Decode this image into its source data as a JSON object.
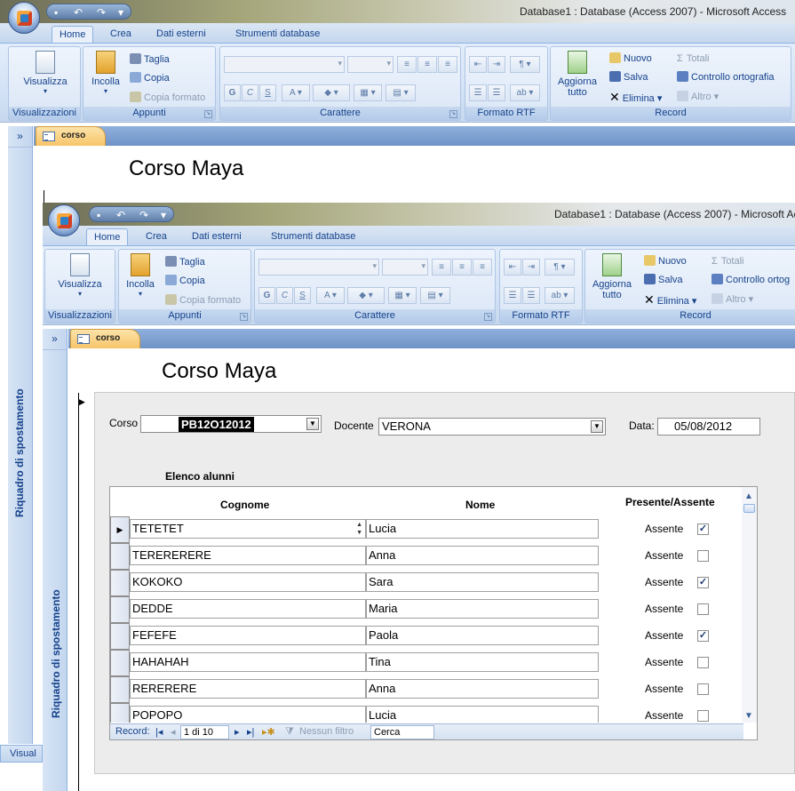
{
  "window_title": "Database1 : Database (Access 2007) - Microsoft Access",
  "window_title_inner": "Database1 : Database (Access 2007) - Microsoft Acc",
  "tabs": [
    "Home",
    "Crea",
    "Dati esterni",
    "Strumenti database"
  ],
  "ribbon": {
    "visualizza": "Visualizza",
    "incolla": "Incolla",
    "taglia": "Taglia",
    "copia": "Copia",
    "copia_formato": "Copia formato",
    "aggiorna_1": "Aggiorna",
    "aggiorna_2": "tutto",
    "nuovo": "Nuovo",
    "salva": "Salva",
    "elimina": "Elimina",
    "totali": "Totali",
    "controllo": "Controllo ortografia",
    "controllo_inner": "Controllo ortog",
    "altro": "Altro",
    "bold": "G",
    "italic": "C",
    "underline": "S",
    "groups": {
      "visualizzazioni": "Visualizzazioni",
      "appunti": "Appunti",
      "carattere": "Carattere",
      "formato_rtf": "Formato RTF",
      "record": "Record"
    }
  },
  "nav_pane": {
    "label": "Riquadro di spostamento",
    "chevron": "»"
  },
  "doc_tab": "corso",
  "form": {
    "title": "Corso Maya",
    "corso_label": "Corso",
    "corso_value": "PB12O12012",
    "docente_label": "Docente",
    "docente_value": "VERONA",
    "data_label": "Data:",
    "data_value": "05/08/2012",
    "elenco_label": "Elenco alunni"
  },
  "subform": {
    "headers": {
      "cognome": "Cognome",
      "nome": "Nome",
      "presente": "Presente/Assente"
    },
    "rows": [
      {
        "cognome": "TETETET",
        "nome": "Lucia",
        "stato": "Assente",
        "checked": true
      },
      {
        "cognome": "TERERERERE",
        "nome": "Anna",
        "stato": "Assente",
        "checked": false
      },
      {
        "cognome": "KOKOKO",
        "nome": "Sara",
        "stato": "Assente",
        "checked": true
      },
      {
        "cognome": "DEDDE",
        "nome": "Maria",
        "stato": "Assente",
        "checked": false
      },
      {
        "cognome": "FEFEFE",
        "nome": "Paola",
        "stato": "Assente",
        "checked": true
      },
      {
        "cognome": "HAHAHAH",
        "nome": "Tina",
        "stato": "Assente",
        "checked": false
      },
      {
        "cognome": "RERERERE",
        "nome": "Anna",
        "stato": "Assente",
        "checked": false
      },
      {
        "cognome": "POPOPO",
        "nome": "Lucia",
        "stato": "Assente",
        "checked": false
      }
    ],
    "recbar": {
      "record_label": "Record:",
      "position": "1 di 10",
      "filter": "Nessun filtro",
      "search": "Cerca"
    }
  },
  "status_bottom": "Visual",
  "colors": {
    "ribbon": "#d3e2f6",
    "accent": "#15428b",
    "doc_tab": "#f7c569"
  }
}
